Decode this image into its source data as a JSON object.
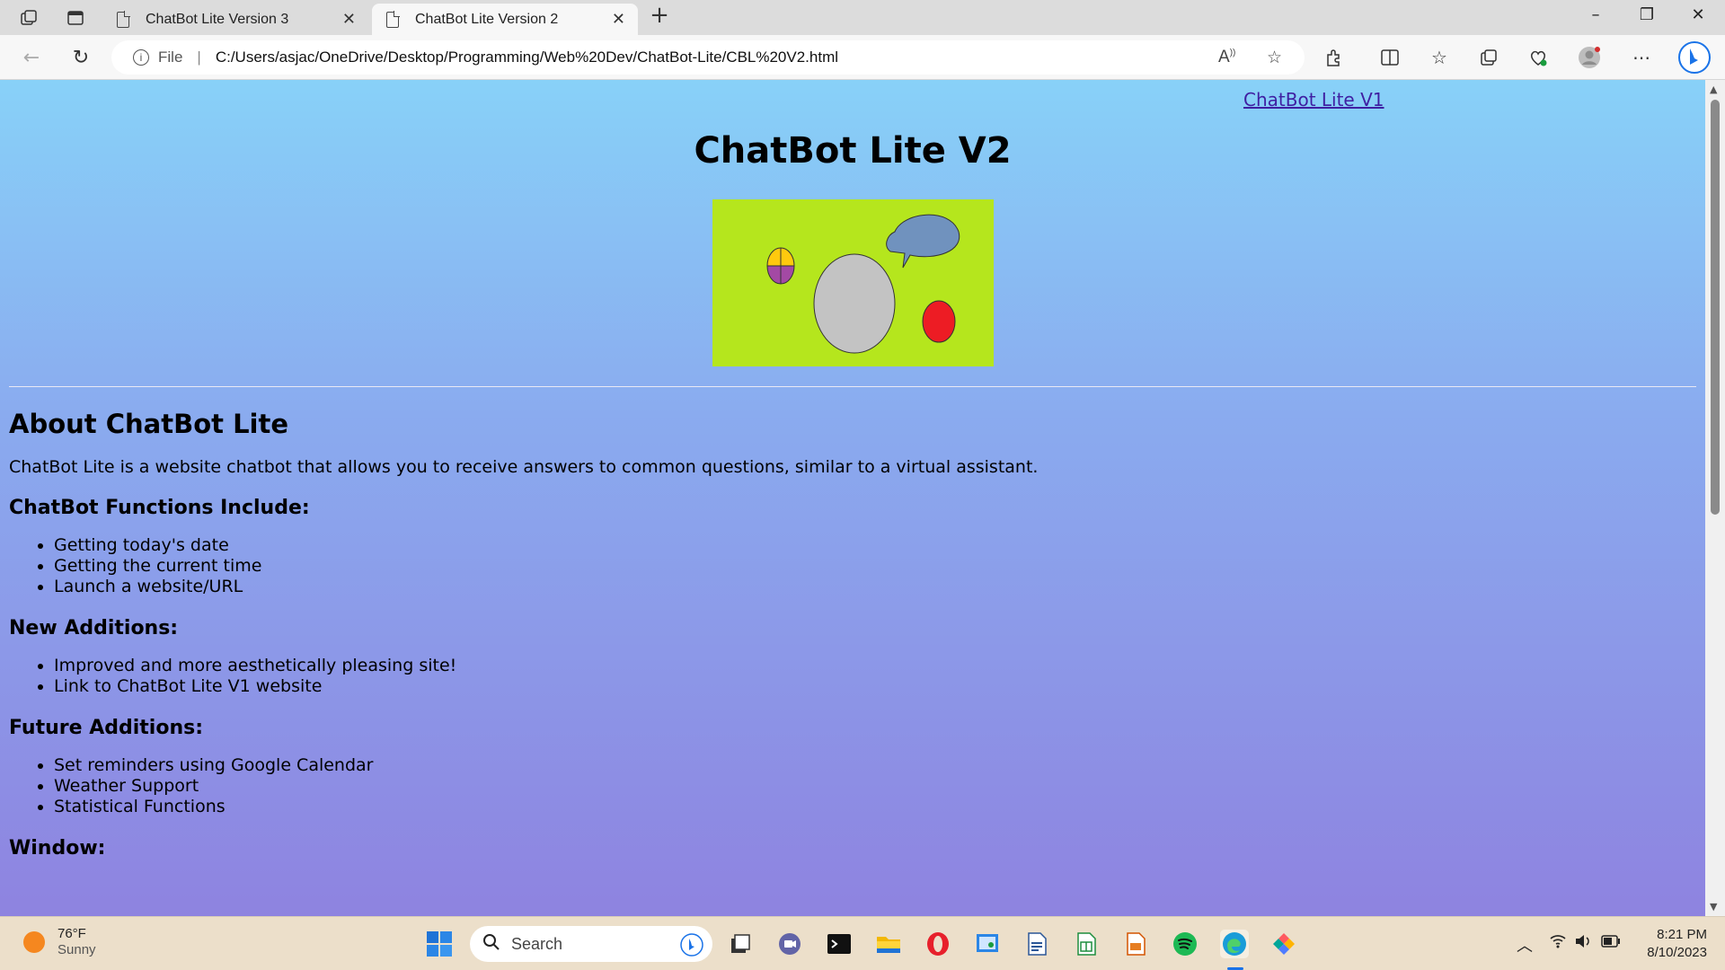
{
  "browser": {
    "tabs": [
      {
        "title": "ChatBot Lite Version 3",
        "active": false
      },
      {
        "title": "ChatBot Lite Version 2",
        "active": true
      }
    ],
    "new_tab_symbol": "+",
    "address": {
      "scheme_label": "File",
      "url": "C:/Users/asjac/OneDrive/Desktop/Programming/Web%20Dev/ChatBot-Lite/CBL%20V2.html"
    },
    "icons": [
      "workspaces-icon",
      "tab-actions-icon",
      "back-icon",
      "refresh-icon",
      "read-aloud-icon",
      "favorite-icon",
      "extensions-icon",
      "split-screen-icon",
      "favorites-icon",
      "collections-icon",
      "performance-icon",
      "profile-icon",
      "more-icon",
      "bing-icon"
    ]
  },
  "page": {
    "v1_link": "ChatBot Lite V1",
    "title": "ChatBot Lite V2",
    "logo": {
      "background": "#b5e61d",
      "colors": {
        "bubble": "#7092be",
        "head": "#c3c3c3",
        "red": "#ed1c24",
        "orb_top": "#ffc90e",
        "orb_bottom": "#a349a4"
      }
    },
    "about_heading": "About ChatBot Lite",
    "about_text": "ChatBot Lite is a website chatbot that allows you to receive answers to common questions, similar to a virtual assistant.",
    "functions_heading": "ChatBot Functions Include:",
    "functions": [
      "Getting today's date",
      "Getting the current time",
      "Launch a website/URL"
    ],
    "new_heading": "New Additions:",
    "new_items": [
      "Improved and more aesthetically pleasing site!",
      "Link to ChatBot Lite V1 website"
    ],
    "future_heading": "Future Additions:",
    "future_items": [
      "Set reminders using Google Calendar",
      "Weather Support",
      "Statistical Functions"
    ],
    "window_heading": "Window:"
  },
  "taskbar": {
    "weather": {
      "temp": "76°F",
      "condition": "Sunny"
    },
    "search_label": "Search",
    "clock": {
      "time": "8:21 PM",
      "date": "8/10/2023"
    }
  }
}
